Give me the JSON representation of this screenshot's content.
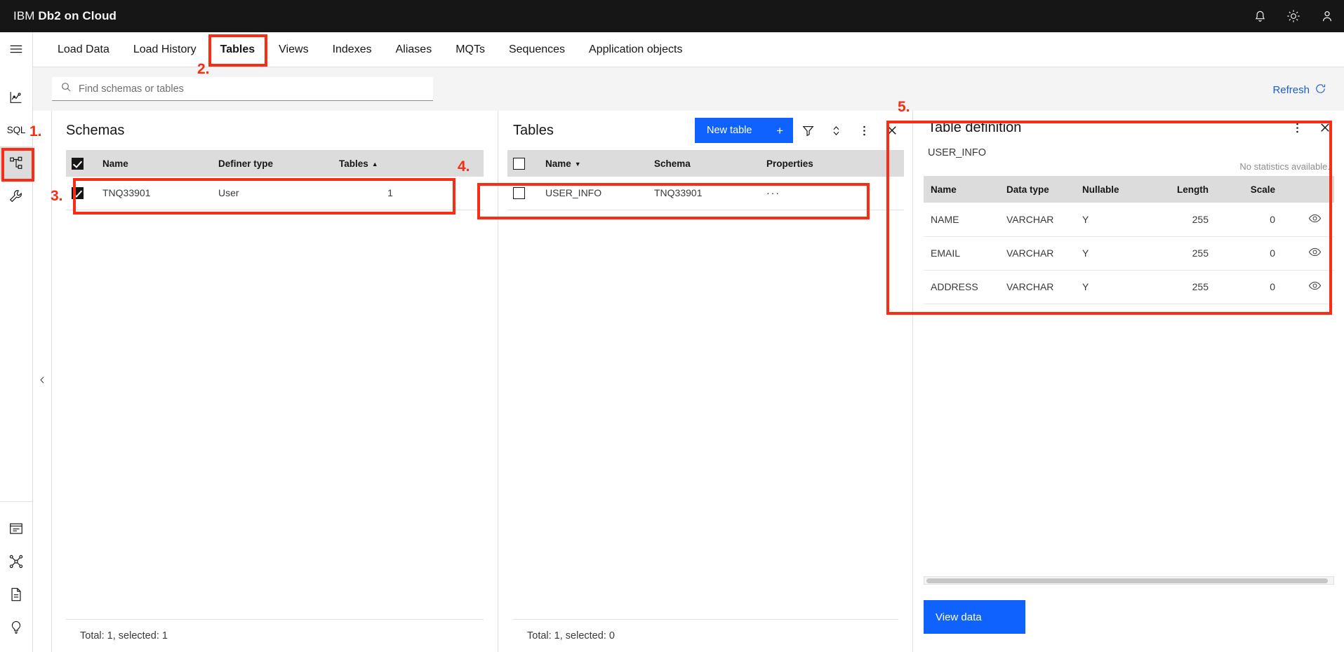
{
  "header": {
    "brand_prefix": "IBM",
    "brand_name": "Db2 on Cloud",
    "icons": [
      {
        "name": "notifications-icon",
        "label": "bell-icon"
      },
      {
        "name": "appearance-icon",
        "label": "brightness-icon"
      },
      {
        "name": "account-icon",
        "label": "user-icon"
      }
    ]
  },
  "rail": {
    "items": [
      {
        "name": "menu-icon",
        "label": "hamburger-menu"
      },
      {
        "name": "monitoring-icon",
        "label": "chart-monitor"
      },
      {
        "name": "sql-icon",
        "label": "SQL"
      },
      {
        "name": "data-objects-icon",
        "label": "schema-objects",
        "selected": true
      },
      {
        "name": "administration-icon",
        "label": "wrench"
      },
      {
        "name": "console-icon",
        "label": "terminal"
      },
      {
        "name": "integration-icon",
        "label": "graph-nodes"
      },
      {
        "name": "documentation-icon",
        "label": "document"
      },
      {
        "name": "help-icon",
        "label": "lightbulb"
      }
    ]
  },
  "nav": {
    "tabs": [
      {
        "label": "Load Data",
        "active": false
      },
      {
        "label": "Load History",
        "active": false
      },
      {
        "label": "Tables",
        "active": true
      },
      {
        "label": "Views",
        "active": false
      },
      {
        "label": "Indexes",
        "active": false
      },
      {
        "label": "Aliases",
        "active": false
      },
      {
        "label": "MQTs",
        "active": false
      },
      {
        "label": "Sequences",
        "active": false
      },
      {
        "label": "Application objects",
        "active": false
      }
    ]
  },
  "search": {
    "placeholder": "Find schemas or tables",
    "value": "",
    "icon": "search-icon"
  },
  "refresh": {
    "label": "Refresh",
    "icon": "refresh-icon",
    "color": "#1b5bd7"
  },
  "schemas_panel": {
    "title": "Schemas",
    "columns": [
      "Name",
      "Definer type",
      "Tables"
    ],
    "sort_column": "Tables",
    "sort_direction": "asc",
    "header_checkbox_checked": true,
    "rows": [
      {
        "checked": true,
        "name": "TNQ33901",
        "definer_type": "User",
        "tables": "1"
      }
    ],
    "footer": "Total: 1, selected: 1"
  },
  "tables_panel": {
    "title": "Tables",
    "new_table_label": "New table",
    "new_table_icon": "plus-icon",
    "toolbar_icons": [
      {
        "name": "filter-icon"
      },
      {
        "name": "sort-icon"
      },
      {
        "name": "overflow-menu-icon"
      },
      {
        "name": "close-icon"
      }
    ],
    "columns": [
      "Name",
      "Schema",
      "Properties"
    ],
    "sort_column": "Name",
    "sort_direction": "desc",
    "header_checkbox_checked": false,
    "rows": [
      {
        "checked": false,
        "name": "USER_INFO",
        "schema": "TNQ33901",
        "properties": "···"
      }
    ],
    "footer": "Total: 1, selected: 0"
  },
  "table_definition_panel": {
    "title": "Table definition",
    "table_name": "USER_INFO",
    "statistics_note": "No statistics available.",
    "header_icons": [
      {
        "name": "overflow-menu-icon"
      },
      {
        "name": "close-icon"
      }
    ],
    "columns": [
      "Name",
      "Data type",
      "Nullable",
      "Length",
      "Scale"
    ],
    "rows": [
      {
        "name": "NAME",
        "data_type": "VARCHAR",
        "nullable": "Y",
        "length": "255",
        "scale": "0",
        "action_icon": "view-icon"
      },
      {
        "name": "EMAIL",
        "data_type": "VARCHAR",
        "nullable": "Y",
        "length": "255",
        "scale": "0",
        "action_icon": "view-icon"
      },
      {
        "name": "ADDRESS",
        "data_type": "VARCHAR",
        "nullable": "Y",
        "length": "255",
        "scale": "0",
        "action_icon": "view-icon"
      }
    ],
    "view_data_label": "View data"
  },
  "annotations": {
    "color": "#fa2d14",
    "markers": [
      {
        "label": "1.",
        "target": "rail-data-objects-icon"
      },
      {
        "label": "2.",
        "target": "nav-tab-tables"
      },
      {
        "label": "3.",
        "target": "schemas-row-tnq33901"
      },
      {
        "label": "4.",
        "target": "tables-row-user-info"
      },
      {
        "label": "5.",
        "target": "table-definition-panel"
      }
    ]
  }
}
